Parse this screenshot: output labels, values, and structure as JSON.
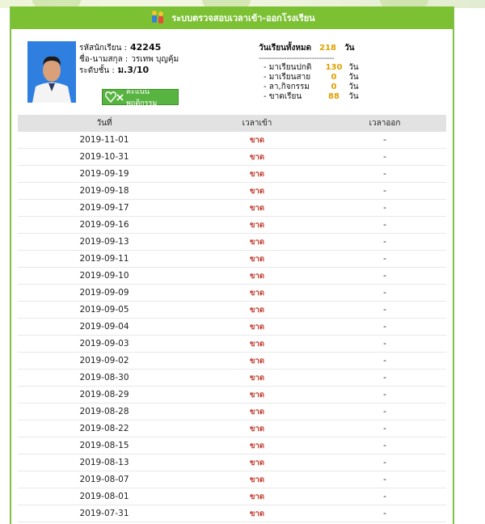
{
  "header": {
    "title": "ระบบตรวจสอบเวลาเข้า-ออกโรงเรียน",
    "icon": "people-icon"
  },
  "student": {
    "id_label": "รหัสนักเรียน :",
    "id_value": "42245",
    "name_label": "ชื่อ-นามสกุล :",
    "name_value": "วรเทพ บุญคุ้ม",
    "class_label": "ระดับชั้น :",
    "class_value": "ม.3/10",
    "behavior_button": "คะแนนพฤติกรรม"
  },
  "summary": {
    "total_label": "วันเรียนทั้งหมด",
    "total_value": "218",
    "unit": "วัน",
    "separator": "------------------------------",
    "normal_label": "- มาเรียนปกติ",
    "normal_value": "130",
    "late_label": "- มาเรียนสาย",
    "late_value": "0",
    "leave_label": "- ลา,กิจกรรม",
    "leave_value": "0",
    "absent_label": "- ขาดเรียน",
    "absent_value": "88"
  },
  "table": {
    "headers": [
      "วันที่",
      "เวลาเข้า",
      "เวลาออก"
    ],
    "rows": [
      {
        "date": "2019-11-01",
        "in": "ขาด",
        "out": "-"
      },
      {
        "date": "2019-10-31",
        "in": "ขาด",
        "out": "-"
      },
      {
        "date": "2019-09-19",
        "in": "ขาด",
        "out": "-"
      },
      {
        "date": "2019-09-18",
        "in": "ขาด",
        "out": "-"
      },
      {
        "date": "2019-09-17",
        "in": "ขาด",
        "out": "-"
      },
      {
        "date": "2019-09-16",
        "in": "ขาด",
        "out": "-"
      },
      {
        "date": "2019-09-13",
        "in": "ขาด",
        "out": "-"
      },
      {
        "date": "2019-09-11",
        "in": "ขาด",
        "out": "-"
      },
      {
        "date": "2019-09-10",
        "in": "ขาด",
        "out": "-"
      },
      {
        "date": "2019-09-09",
        "in": "ขาด",
        "out": "-"
      },
      {
        "date": "2019-09-05",
        "in": "ขาด",
        "out": "-"
      },
      {
        "date": "2019-09-04",
        "in": "ขาด",
        "out": "-"
      },
      {
        "date": "2019-09-03",
        "in": "ขาด",
        "out": "-"
      },
      {
        "date": "2019-09-02",
        "in": "ขาด",
        "out": "-"
      },
      {
        "date": "2019-08-30",
        "in": "ขาด",
        "out": "-"
      },
      {
        "date": "2019-08-29",
        "in": "ขาด",
        "out": "-"
      },
      {
        "date": "2019-08-28",
        "in": "ขาด",
        "out": "-"
      },
      {
        "date": "2019-08-22",
        "in": "ขาด",
        "out": "-"
      },
      {
        "date": "2019-08-15",
        "in": "ขาด",
        "out": "-"
      },
      {
        "date": "2019-08-13",
        "in": "ขาด",
        "out": "-"
      },
      {
        "date": "2019-08-07",
        "in": "ขาด",
        "out": "-"
      },
      {
        "date": "2019-08-01",
        "in": "ขาด",
        "out": "-"
      },
      {
        "date": "2019-07-31",
        "in": "ขาด",
        "out": "-"
      }
    ]
  },
  "colors": {
    "banner": "#7cc034",
    "absent": "#c0392b",
    "count": "#e0a000"
  }
}
